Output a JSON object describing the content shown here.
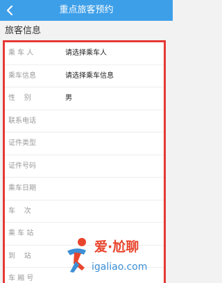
{
  "header": {
    "title": "重点旅客预约",
    "back_icon": "chevron-left-icon",
    "background_color": "#3e9fe9"
  },
  "section": {
    "title": "旅客信息"
  },
  "form": {
    "highlight_color": "#e53935",
    "rows": [
      {
        "label": "乘 车 人",
        "value": "请选择乘车人"
      },
      {
        "label": "乘车信息",
        "value": "请选择乘车信息"
      },
      {
        "label": "性    别",
        "value": "男"
      },
      {
        "label": "联系电话",
        "value": ""
      },
      {
        "label": "证件类型",
        "value": ""
      },
      {
        "label": "证件号码",
        "value": ""
      },
      {
        "label": "乘车日期",
        "value": ""
      },
      {
        "label": "车    次",
        "value": ""
      },
      {
        "label": "乘 车 站",
        "value": ""
      },
      {
        "label": "到    站",
        "value": ""
      },
      {
        "label": "车 厢 号",
        "value": ""
      }
    ]
  },
  "watermark": {
    "chinese": "爱·尬聊",
    "url": "igaliao.com",
    "icon": "running-person-logo"
  }
}
